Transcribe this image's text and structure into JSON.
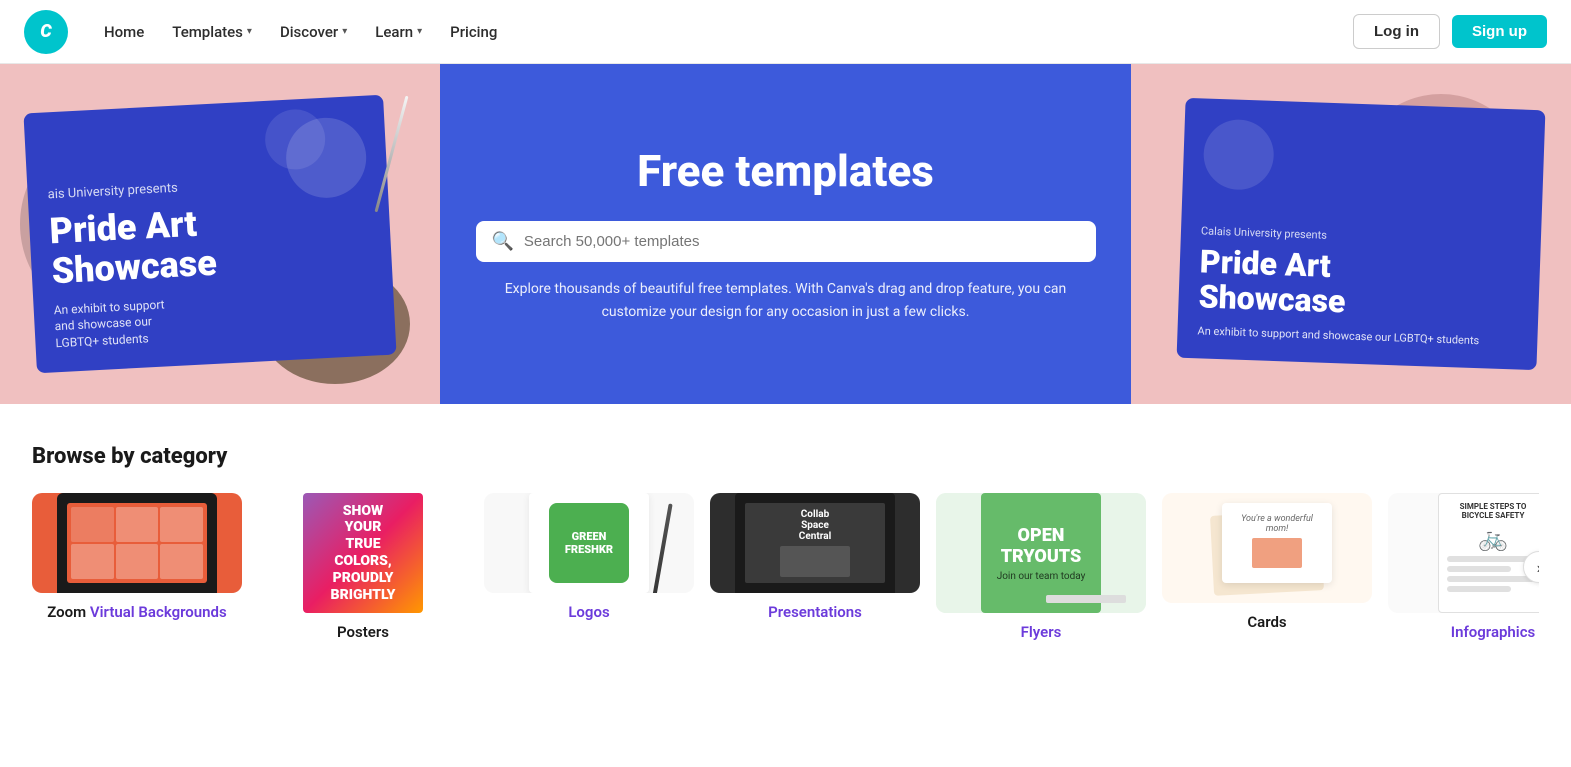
{
  "nav": {
    "logo_text": "C",
    "home": "Home",
    "templates": "Templates",
    "discover": "Discover",
    "learn": "Learn",
    "pricing": "Pricing",
    "login": "Log in",
    "signup": "Sign up"
  },
  "hero": {
    "title": "Free templates",
    "search_placeholder": "Search 50,000+ templates",
    "description": "Explore thousands of beautiful free templates. With Canva's drag and drop feature, you can\ncustomize your design for any occasion in just a few clicks.",
    "left_card_subtitle": "ais University presents",
    "left_card_title": "Pride Art\nShowcase",
    "left_card_body": "An exhibit to support\nand showcase our\nLGBTQ+ students",
    "right_card_subtitle": "Calais University presents",
    "right_card_title": "Pride Art\nShowcase",
    "right_card_body": "An exhibit to support and showcase our LGBTQ+ students"
  },
  "browse": {
    "title": "Browse by category",
    "categories": [
      {
        "id": "zoom",
        "label": "Zoom Virtual Backgrounds",
        "label_plain": "Zoom ",
        "label_link": "Virtual Backgrounds",
        "link_style": false
      },
      {
        "id": "posters",
        "label": "Posters",
        "link_style": false
      },
      {
        "id": "logos",
        "label": "Logos",
        "link_style": true
      },
      {
        "id": "presentations",
        "label": "Presentations",
        "link_style": true
      },
      {
        "id": "flyers",
        "label": "Flyers",
        "link_style": true
      },
      {
        "id": "cards",
        "label": "Cards",
        "link_style": false
      },
      {
        "id": "infographics",
        "label": "Infographics",
        "link_style": true
      }
    ]
  }
}
